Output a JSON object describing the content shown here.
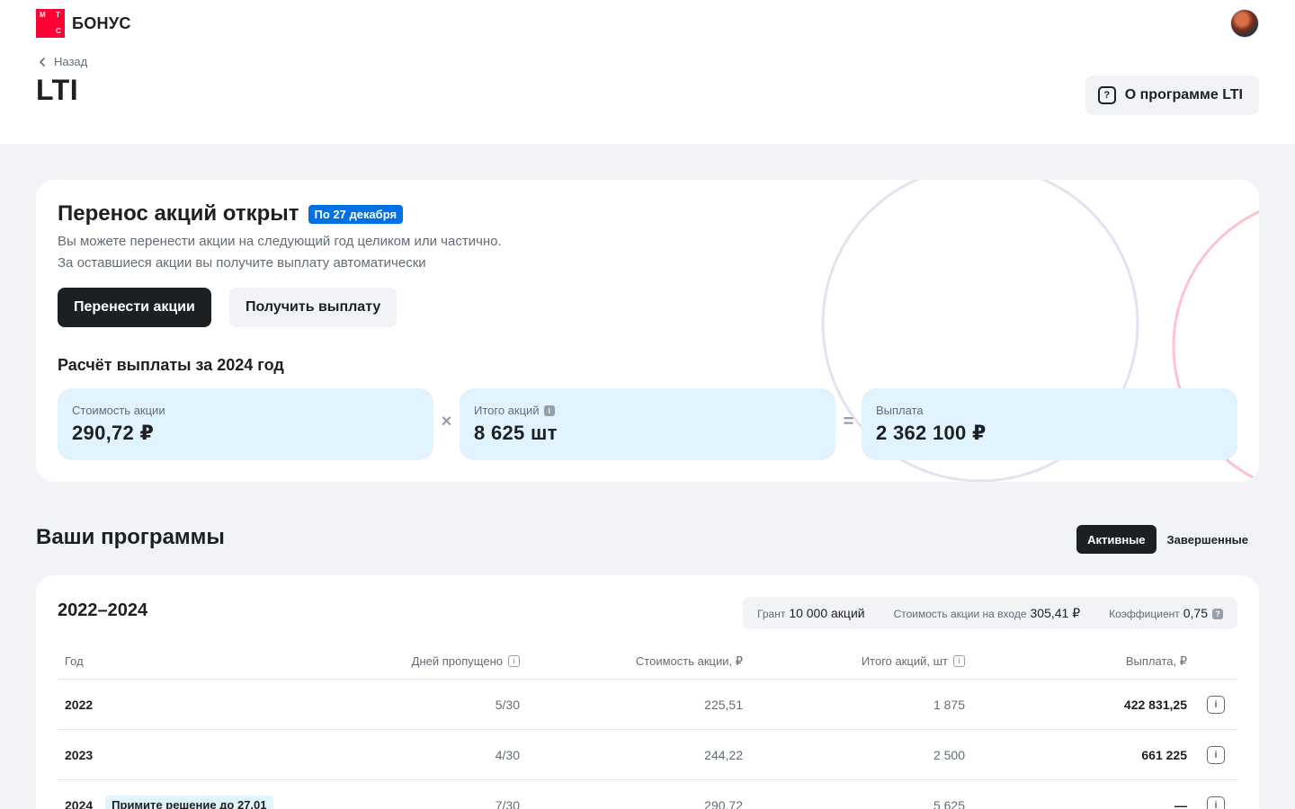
{
  "header": {
    "logo_letters": [
      "М",
      "Т",
      "С"
    ],
    "logo_text": "БОНУС",
    "back_label": "Назад",
    "title": "LTI",
    "about_button": "О программе LTI",
    "about_icon": "?"
  },
  "transfer": {
    "title": "Перенос акций открыт",
    "badge": "По 27 декабря",
    "desc_line1": "Вы можете перенести акции на следующий год целиком или частично.",
    "desc_line2": "За оставшиеся акции вы получите выплату автоматически",
    "primary_button": "Перенести акции",
    "secondary_button": "Получить выплату",
    "calc_title": "Расчёт выплаты за 2024 год",
    "price_label": "Стоимость акции",
    "price_value": "290,72 ₽",
    "multiply": "×",
    "shares_label": "Итого акций",
    "shares_value": "8 625 шт",
    "equals": "=",
    "payout_label": "Выплата",
    "payout_value": "2 362 100 ₽"
  },
  "programs": {
    "title": "Ваши программы",
    "tabs": [
      "Активные",
      "Завершенные"
    ],
    "period": "2022–2024",
    "grant_label": "Грант",
    "grant_value": "10 000 акций",
    "entry_price_label": "Стоимость акции на входе",
    "entry_price_value": "305,41 ₽",
    "coef_label": "Коэффициент",
    "coef_value": "0,75",
    "columns": [
      "Год",
      "Дней пропущено",
      "Стоимость акции, ₽",
      "Итого акций, шт",
      "Выплата, ₽"
    ],
    "rows": [
      {
        "year": "2022",
        "days": "5/30",
        "price": "225,51",
        "shares": "1 875",
        "payout": "422 831,25",
        "tag": ""
      },
      {
        "year": "2023",
        "days": "4/30",
        "price": "244,22",
        "shares": "2 500",
        "payout": "661 225",
        "tag": ""
      },
      {
        "year": "2024",
        "days": "7/30",
        "price": "290,72",
        "shares": "5 625",
        "payout": "—",
        "tag": "Примите решение до 27.01"
      }
    ]
  },
  "colors": {
    "accent": "#ff0032",
    "badge_blue": "#0070e5",
    "light_blue": "#e1f3fe",
    "dark": "#1d2023",
    "background": "#f2f3f7"
  }
}
